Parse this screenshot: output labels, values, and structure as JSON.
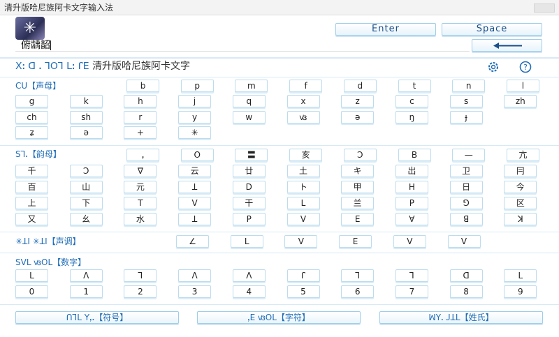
{
  "window": {
    "title": "清升版哈尼族阿卡文字输入法"
  },
  "logo": {
    "glyph": "✳"
  },
  "top": {
    "enter": "Enter",
    "space": "Space"
  },
  "input": {
    "value": "俯龋韶"
  },
  "banner": {
    "script_text": "ꓫꓽ ꓷ ꓸ ꓶꓳꓶ ꓡꓽ ꓩꓰ",
    "cn_text": "清升版哈尼族阿卡文字"
  },
  "consonants": {
    "label": "ꓚꓴ【声母】",
    "row1": [
      "b",
      "p",
      "m",
      "f",
      "d",
      "t",
      "n",
      "l"
    ],
    "row2": [
      "g",
      "k",
      "h",
      "j",
      "q",
      "x",
      "z",
      "c",
      "s",
      "zh"
    ],
    "row3": [
      "ch",
      "sh",
      "r",
      "y",
      "w",
      "ꟃ",
      "ə",
      "ŋ",
      "ɟ"
    ],
    "row4": [
      "ʑ",
      "ə",
      "+",
      "✳"
    ]
  },
  "vowels": {
    "label": "Sꓶꓸ【韵母】",
    "row1": [
      "ꓹ",
      "ꓳ",
      "〓",
      "亥",
      "ꓛ",
      "ꓐ",
      "—",
      "亢"
    ],
    "row2": [
      "千",
      "ꓛ",
      "∇",
      "云",
      "廿",
      "土",
      "キ",
      "出",
      "卫",
      "冃"
    ],
    "row3": [
      "百",
      "山",
      "元",
      "ꓕ",
      "ꓓ",
      "ト",
      "甲",
      "ꓧ",
      "日",
      "今"
    ],
    "row4": [
      "上",
      "下",
      "ꓔ",
      "ꓦ",
      "干",
      "ꓡ",
      "兰",
      "ꓑ",
      "ꓨ",
      "区"
    ],
    "row5": [
      "又",
      "幺",
      "水",
      "ꓕ",
      "ꓑ",
      "V",
      "ꓰ",
      "ꓯ",
      "ꓭ",
      "ꓘ"
    ]
  },
  "tones": {
    "label": "✳ꓕꓲ ✳ꓕꓲ【声调】",
    "keys": [
      "∠",
      "L",
      "ꓦ",
      "ꓰ",
      "ꓦ",
      "ꓦ"
    ]
  },
  "numbers": {
    "label": "Sꓦꓡ ꟃꓳꓡ【数字】",
    "symbols": [
      "ꓡ",
      "ꓥ",
      "ꓶ",
      "ꓥ",
      "ꓥ",
      "ꓩ",
      "ꓶ",
      "ꓶ",
      "ꓷ",
      "ꓡ"
    ],
    "digits": [
      "0",
      "1",
      "2",
      "3",
      "4",
      "5",
      "6",
      "7",
      "8",
      "9"
    ]
  },
  "bottom": {
    "symbols": "ꓵꓶꓡ ꓬꓹꓸ【符号】",
    "chars": "ꓹꓰ ꟃꓳꓡ【字符】",
    "surname": "ꟽꓬꓸ ꓙꓕꓡ【姓氏】"
  },
  "colors": {
    "accent": "#1f6db8",
    "key_border": "#bcdcee"
  }
}
